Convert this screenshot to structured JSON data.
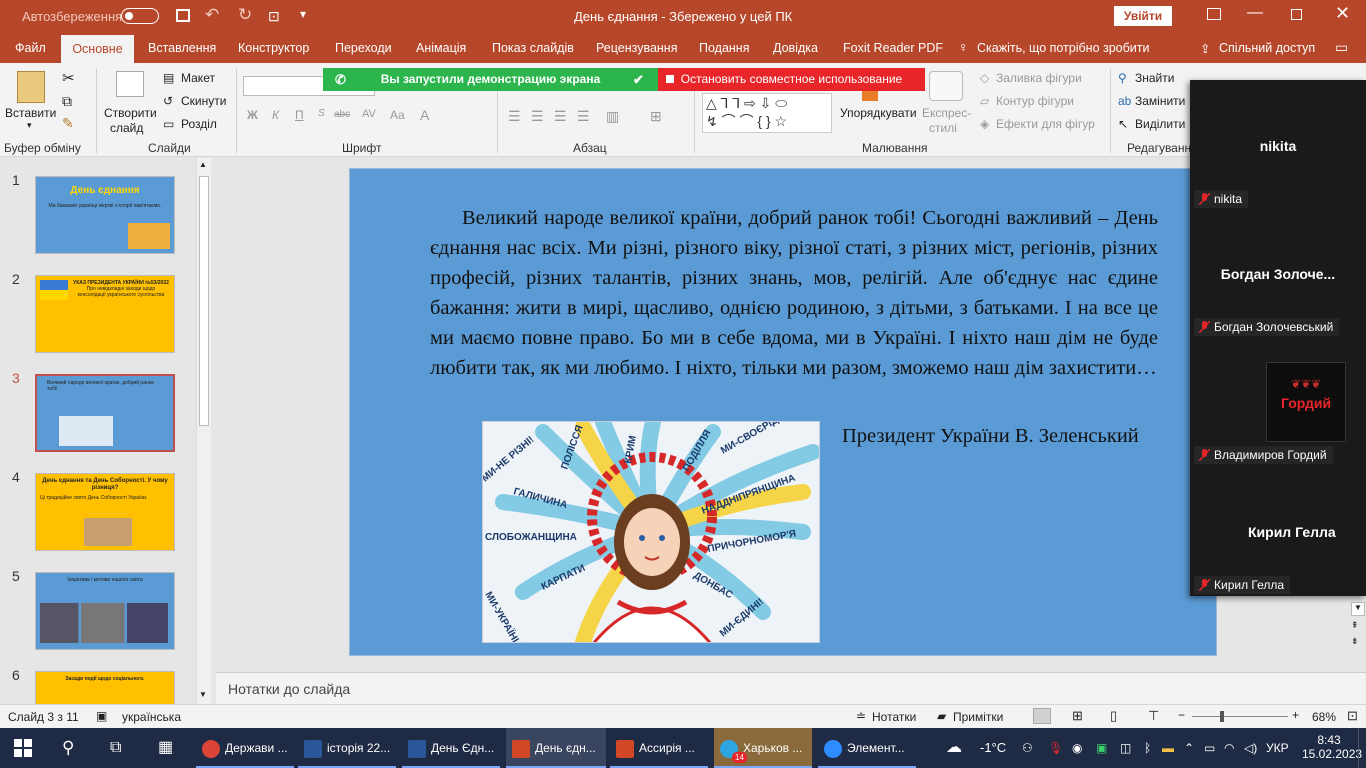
{
  "titlebar": {
    "autosave": "Автозбереження",
    "title": "День єднання  -  Збережено у цей ПК",
    "signin": "Увійти"
  },
  "tabs": [
    "Файл",
    "Основне",
    "Вставлення",
    "Конструктор",
    "Переходи",
    "Анімація",
    "Показ слайдів",
    "Рецензування",
    "Подання",
    "Довідка",
    "Foxit Reader PDF",
    "Скажіть, що потрібно зробити",
    "Спільний доступ"
  ],
  "ribbon": {
    "paste": "Вставити",
    "new_slide_1": "Створити",
    "new_slide_2": "слайд",
    "layout": "Макет",
    "reset": "Скинути",
    "section": "Розділ",
    "arrange": "Упорядкувати",
    "express_1": "Експрес-",
    "express_2": "стилі",
    "fill": "Заливка фігури",
    "outline": "Контур фігури",
    "effects": "Ефекти для фігур",
    "find": "Знайти",
    "replace": "Замінити",
    "select": "Виділити",
    "groups": {
      "clipboard": "Буфер обміну",
      "slides": "Слайди",
      "font": "Шрифт",
      "paragraph": "Абзац",
      "drawing": "Малювання",
      "editing": "Редагування"
    },
    "font_buttons": [
      "Ж",
      "К",
      "П",
      "abc",
      "AV",
      "Aa"
    ]
  },
  "banner": {
    "sharing": "Вы запустили демонстрацию экрана",
    "stop": "Остановить совместное использование"
  },
  "thumbnails": [
    {
      "num": "1",
      "title": "День єднання",
      "text": "Ми бажаємо українці жертві з історії пам'ятаємо."
    },
    {
      "num": "2",
      "title": "УКАЗ ПРЕЗИДЕНТА УКРАЇНИ №53/2022",
      "text": "Про невідкладні заходи щодо консолідації українського суспільства"
    },
    {
      "num": "3",
      "title": "",
      "text": "Великий народе великої країни, добрий ранок тобі!"
    },
    {
      "num": "4",
      "title": "День єднання та День Соборності. У чому різниця?",
      "text": "Ці традиційне свято День Соборності України."
    },
    {
      "num": "5",
      "title": "",
      "text": "Ініціатива і мотиви нашого свята"
    },
    {
      "num": "6",
      "title": "",
      "text": "Засади події щодо соціального."
    }
  ],
  "slide": {
    "text": "Великий народе великої країни, добрий ранок тобі! Сьогодні важливий – День єднання нас всіх. Ми різні, різного віку, різної статі, з різних міст, регіонів, різних професій, різних талантів, різних знань, мов, релігій. Але об'єднує нас єдине бажання: жити в мирі, щасливо, однією родиною, з дітьми, з батьками. І на все це ми маємо повне право. Бо ми в себе вдома, ми в Україні. І ніхто наш дім не буде любити так, як ми любимо. І ніхто, тільки ми разом, зможемо наш дім захистити…",
    "author": "Президент України В. Зеленський",
    "picture_words": [
      "МИ-НЕ РІЗНІ!",
      "ПОЛІССЯ",
      "КРИМ",
      "ПОДІЛЛЯ",
      "МИ-СВОЄРІДНІ!",
      "ГАЛИЧИНА",
      "НАДДНІПРЯНЩИНА",
      "СЛОБОЖАНЩИНА",
      "ПРИЧОРНОМОР'Я",
      "КАРПАТИ",
      "ДОНБАС",
      "МИ-УКРАЇНЦІ!",
      "МИ-ЄДИНІ!"
    ]
  },
  "notes": "Нотатки до слайда",
  "status": {
    "slide": "Слайд 3 з 11",
    "lang": "українська",
    "notes": "Нотатки",
    "comments": "Примітки",
    "zoom": "68%"
  },
  "participants": [
    {
      "tile": "nikita",
      "label": "nikita"
    },
    {
      "tile": "Богдан  Золоче...",
      "label": "Богдан Золочевський"
    },
    {
      "tile": "Гордий",
      "label": "Владимиров Гордий"
    },
    {
      "tile": "Кирил Гелла",
      "label": "Кирил Гелла"
    }
  ],
  "taskbar": {
    "items": [
      {
        "label": "Держави ...",
        "color": "#db4437"
      },
      {
        "label": "історія 22...",
        "color": "#2b579a"
      },
      {
        "label": "День Єдн...",
        "color": "#2b579a"
      },
      {
        "label": "День єдн...",
        "color": "#d24726"
      },
      {
        "label": "Ассирія ...",
        "color": "#d24726"
      },
      {
        "label": "Харьков ...",
        "color": "#2ca5e0"
      },
      {
        "label": "Элемент...",
        "color": "#2d8cff"
      }
    ],
    "telegram_badge": "14",
    "weather": "-1°C",
    "lang": "УКР",
    "time": "8:43",
    "date": "15.02.2023"
  },
  "colors": {
    "ppt_accent": "#b7472a",
    "slide_bg": "#5b9bd5",
    "thumb_yellow": "#ffc000"
  }
}
